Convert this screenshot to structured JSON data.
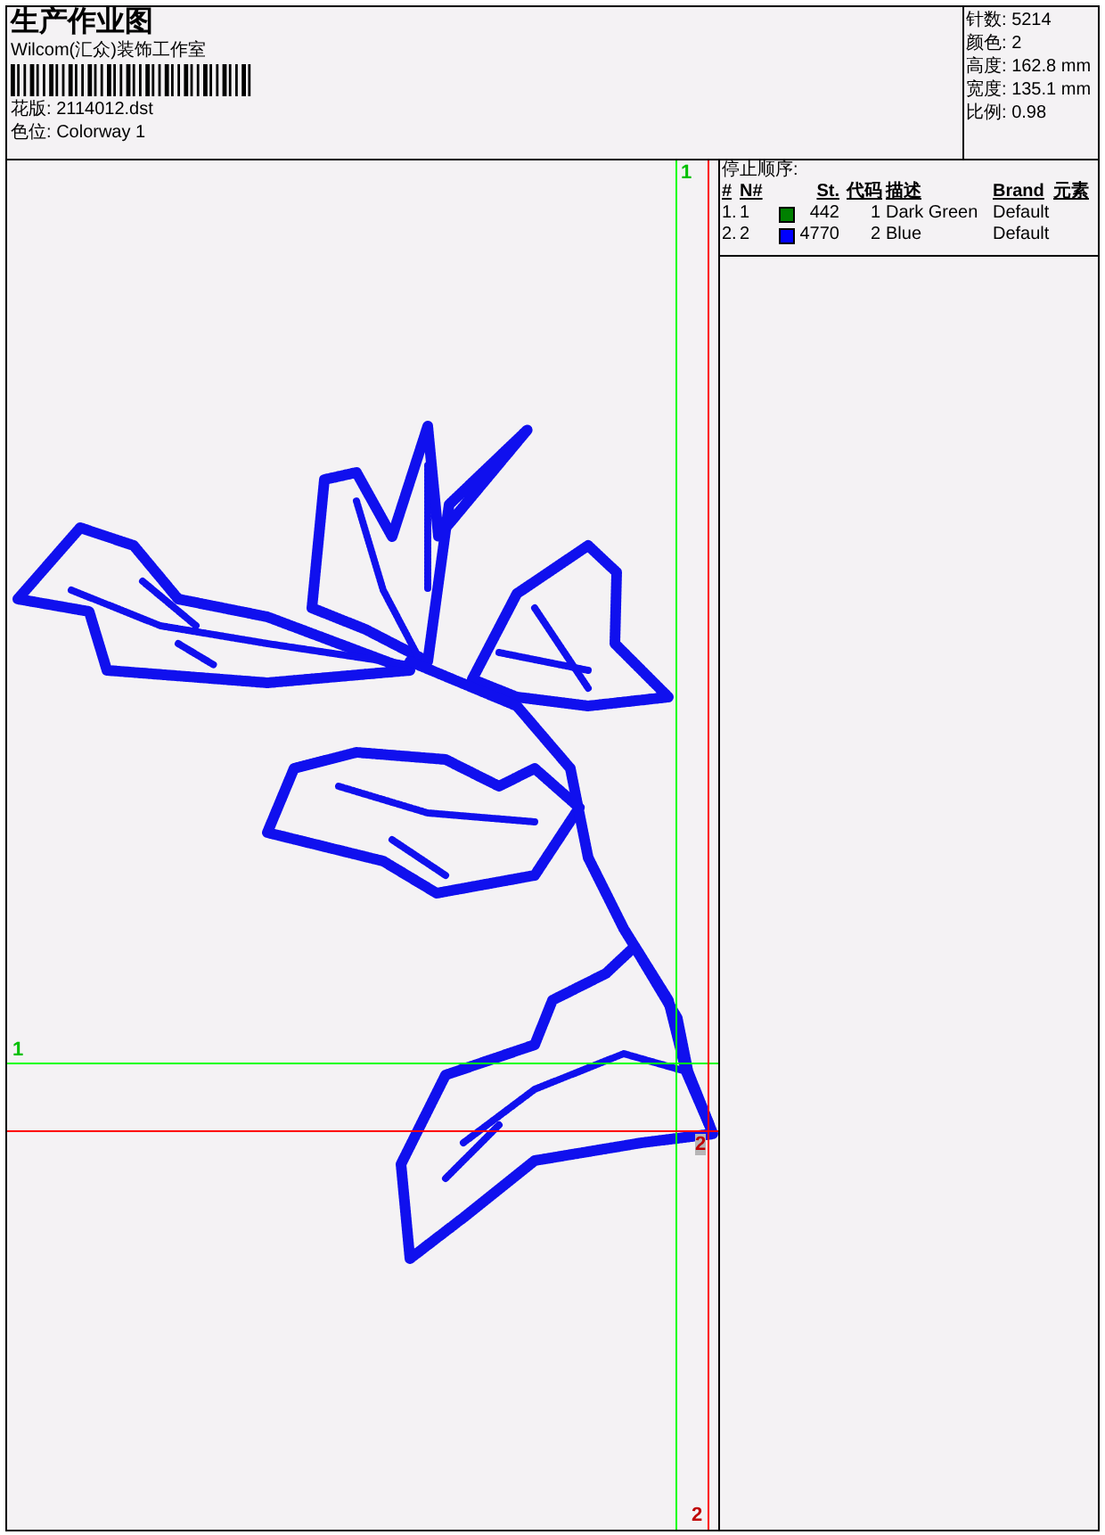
{
  "header": {
    "title": "生产作业图",
    "company": "Wilcom(汇众)装饰工作室",
    "design": {
      "label": "花版:",
      "value": "2114012.dst"
    },
    "colorway": {
      "label": "色位:",
      "value": "Colorway 1"
    }
  },
  "stats": [
    {
      "label": "针数:",
      "value": "5214"
    },
    {
      "label": "颜色:",
      "value": "2"
    },
    {
      "label": "高度:",
      "value": "162.8 mm"
    },
    {
      "label": "宽度:",
      "value": "135.1 mm"
    },
    {
      "label": "比例:",
      "value": "0.98"
    }
  ],
  "stop_sequence": {
    "title": "停止顺序:",
    "columns": [
      "#",
      "N#",
      "St.",
      "代码",
      "描述",
      "Brand",
      "元素"
    ],
    "rows": [
      {
        "index": "1.",
        "number": "1",
        "color": "#008000",
        "stitches": "442",
        "code": "1",
        "description": "Dark Green",
        "brand": "Default"
      },
      {
        "index": "2.",
        "number": "2",
        "color": "#0000ff",
        "stitches": "4770",
        "code": "2",
        "description": "Blue",
        "brand": "Default"
      }
    ]
  },
  "canvas": {
    "markers": [
      {
        "color": "#00ff00",
        "vertical_label": "1",
        "horizontal_label": "1"
      },
      {
        "color": "#ff0000",
        "vertical_label": "2",
        "horizontal_label": "2"
      }
    ]
  }
}
